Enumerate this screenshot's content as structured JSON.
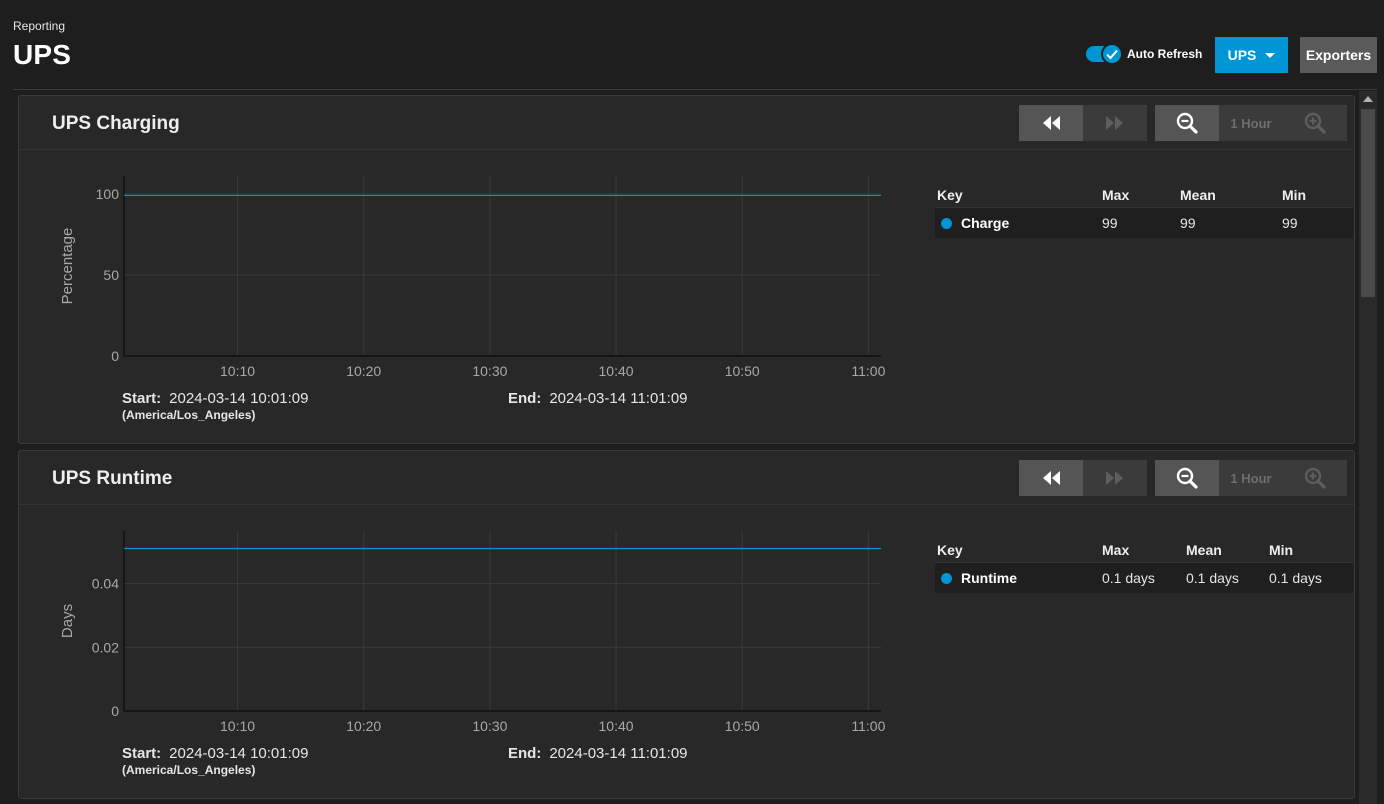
{
  "header": {
    "breadcrumb": "Reporting",
    "title": "UPS",
    "auto_refresh_label": "Auto Refresh",
    "ups_button_label": "UPS",
    "exporters_label": "Exporters"
  },
  "colors": {
    "accent": "#0095d5",
    "background": "#1e1e1e",
    "card": "#282828"
  },
  "cards": [
    {
      "title": "UPS Charging",
      "zoom_label": "1 Hour",
      "start_label": "Start:",
      "start_value": "2024-03-14 10:01:09",
      "timezone": "(America/Los_Angeles)",
      "end_label": "End:",
      "end_value": "2024-03-14 11:01:09",
      "legend": {
        "headers": [
          "Key",
          "Max",
          "Mean",
          "Min"
        ],
        "rows": [
          {
            "key": "Charge",
            "max": "99",
            "mean": "99",
            "min": "99"
          }
        ]
      }
    },
    {
      "title": "UPS Runtime",
      "zoom_label": "1 Hour",
      "start_label": "Start:",
      "start_value": "2024-03-14 10:01:09",
      "timezone": "(America/Los_Angeles)",
      "end_label": "End:",
      "end_value": "2024-03-14 11:01:09",
      "legend": {
        "headers": [
          "Key",
          "Max",
          "Mean",
          "Min"
        ],
        "rows": [
          {
            "key": "Runtime",
            "max": "0.1 days",
            "mean": "0.1 days",
            "min": "0.1 days"
          }
        ]
      }
    }
  ],
  "chart_data": [
    {
      "type": "line",
      "title": "UPS Charging",
      "ylabel": "Percentage",
      "x_ticks": [
        "10:10",
        "10:20",
        "10:30",
        "10:40",
        "10:50",
        "11:00"
      ],
      "y_ticks": [
        "0",
        "50",
        "100"
      ],
      "xlim": [
        "10:01",
        "11:01"
      ],
      "ylim": [
        0,
        111
      ],
      "grid": true,
      "series": [
        {
          "name": "Charge",
          "color": "#0095d5",
          "x": [
            "10:01",
            "11:01"
          ],
          "y": [
            99,
            99
          ]
        }
      ]
    },
    {
      "type": "line",
      "title": "UPS Runtime",
      "ylabel": "Days",
      "x_ticks": [
        "10:10",
        "10:20",
        "10:30",
        "10:40",
        "10:50",
        "11:00"
      ],
      "y_ticks": [
        "0",
        "0.02",
        "0.04"
      ],
      "xlim": [
        "10:01",
        "11:01"
      ],
      "ylim": [
        0,
        0.0565
      ],
      "grid": true,
      "series": [
        {
          "name": "Runtime",
          "color": "#0095d5",
          "x": [
            "10:01",
            "11:01"
          ],
          "y": [
            0.051,
            0.051
          ]
        }
      ]
    }
  ]
}
